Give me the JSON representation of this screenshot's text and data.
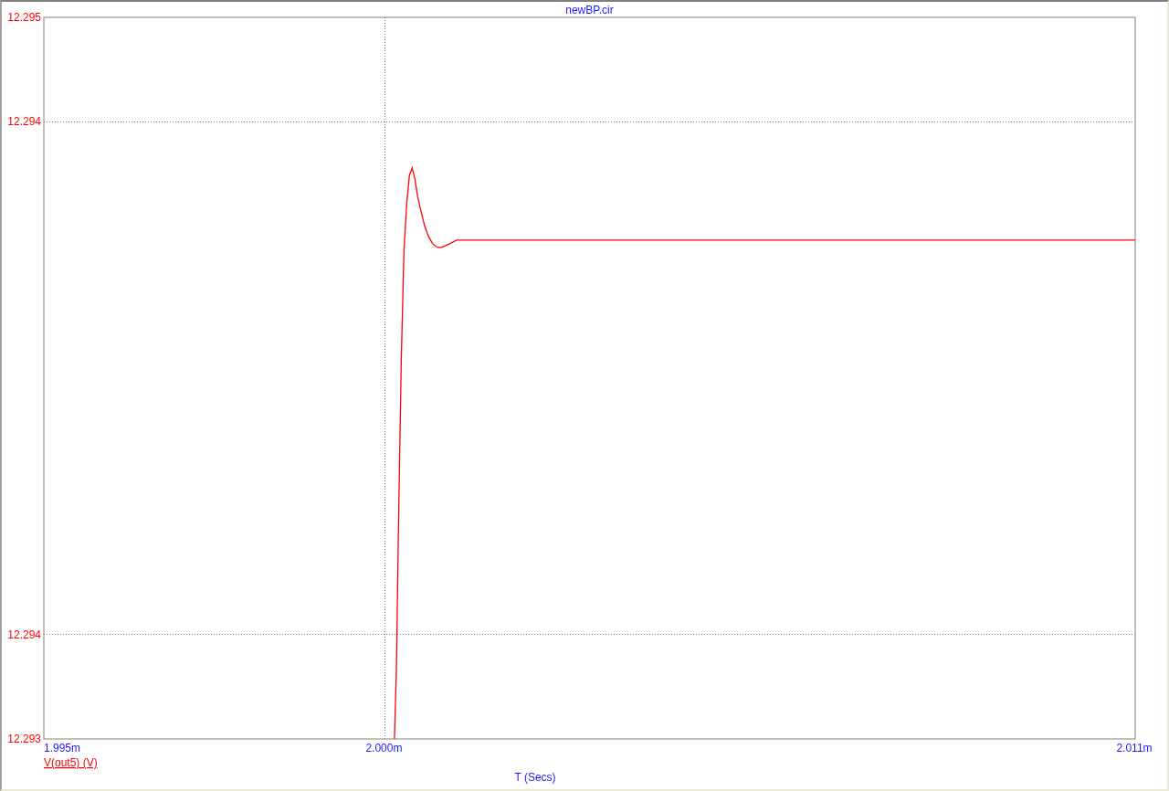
{
  "chart_data": {
    "type": "line",
    "title": "newBP.cir",
    "xlabel": "T (Secs)",
    "xlim": [
      1.995,
      2.011
    ],
    "ylim": [
      12.29331,
      12.29469
    ],
    "grid": true,
    "xticks": [
      {
        "value": 1.995,
        "label": "1.995m"
      },
      {
        "value": 2.0,
        "label": "2.000m"
      },
      {
        "value": 2.011,
        "label": "2.011m"
      }
    ],
    "yticks": [
      {
        "value": 12.29469,
        "label": "12.295"
      },
      {
        "value": 12.29449,
        "label": "12.294"
      },
      {
        "value": 12.29351,
        "label": "12.294"
      },
      {
        "value": 12.29331,
        "label": "12.293"
      }
    ],
    "x": [
      2.00014,
      2.00017,
      2.0002,
      2.00024,
      2.00028,
      2.00032,
      2.00036,
      2.0004,
      2.00044,
      2.00048,
      2.00053,
      2.00058,
      2.00064,
      2.0007,
      2.00077,
      2.00083,
      2.00095,
      2.00105,
      2.011
    ],
    "series": [
      {
        "name": "V(out5) (V)",
        "color": "#ff0000",
        "values": [
          12.29331,
          12.293448,
          12.293725,
          12.294036,
          12.294243,
          12.294333,
          12.294388,
          12.294402,
          12.294381,
          12.294347,
          12.294319,
          12.294292,
          12.294271,
          12.294257,
          12.29425,
          12.29425,
          12.294257,
          12.294264,
          12.294264
        ]
      }
    ]
  }
}
